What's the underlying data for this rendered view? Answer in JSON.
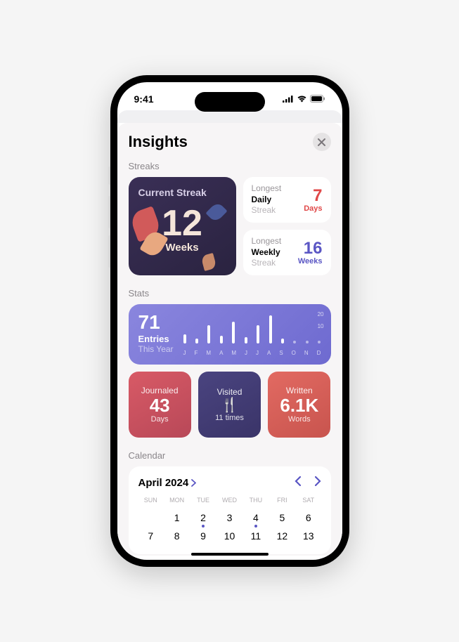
{
  "status": {
    "time": "9:41"
  },
  "header": {
    "title": "Insights"
  },
  "sections": {
    "streaks": "Streaks",
    "stats": "Stats",
    "calendar": "Calendar"
  },
  "current_streak": {
    "label": "Current Streak",
    "value": "12",
    "unit": "Weeks"
  },
  "longest_daily": {
    "l1": "Longest",
    "l2": "Daily",
    "l3": "Streak",
    "value": "7",
    "unit": "Days"
  },
  "longest_weekly": {
    "l1": "Longest",
    "l2": "Weekly",
    "l3": "Streak",
    "value": "16",
    "unit": "Weeks"
  },
  "entries": {
    "value": "71",
    "label": "Entries",
    "sub": "This Year"
  },
  "journaled": {
    "label": "Journaled",
    "value": "43",
    "unit": "Days"
  },
  "visited": {
    "label": "Visited",
    "value": "11 times"
  },
  "written": {
    "label": "Written",
    "value": "6.1K",
    "unit": "Words"
  },
  "calendar": {
    "title": "April 2024",
    "days": [
      "SUN",
      "MON",
      "TUE",
      "WED",
      "THU",
      "FRI",
      "SAT"
    ],
    "row1": [
      "",
      "1",
      "2",
      "3",
      "4",
      "5",
      "6"
    ],
    "row2": [
      "7",
      "8",
      "9",
      "10",
      "11",
      "12",
      "13"
    ]
  },
  "chart_data": {
    "type": "bar",
    "title": "Entries This Year",
    "xlabel": "",
    "ylabel": "",
    "ylim": [
      0,
      20
    ],
    "categories": [
      "J",
      "F",
      "M",
      "A",
      "M",
      "J",
      "J",
      "A",
      "S",
      "O",
      "N",
      "D"
    ],
    "values": [
      6,
      3,
      12,
      5,
      14,
      4,
      12,
      18,
      3,
      0,
      0,
      0
    ],
    "scale_ticks": [
      20,
      10
    ]
  }
}
